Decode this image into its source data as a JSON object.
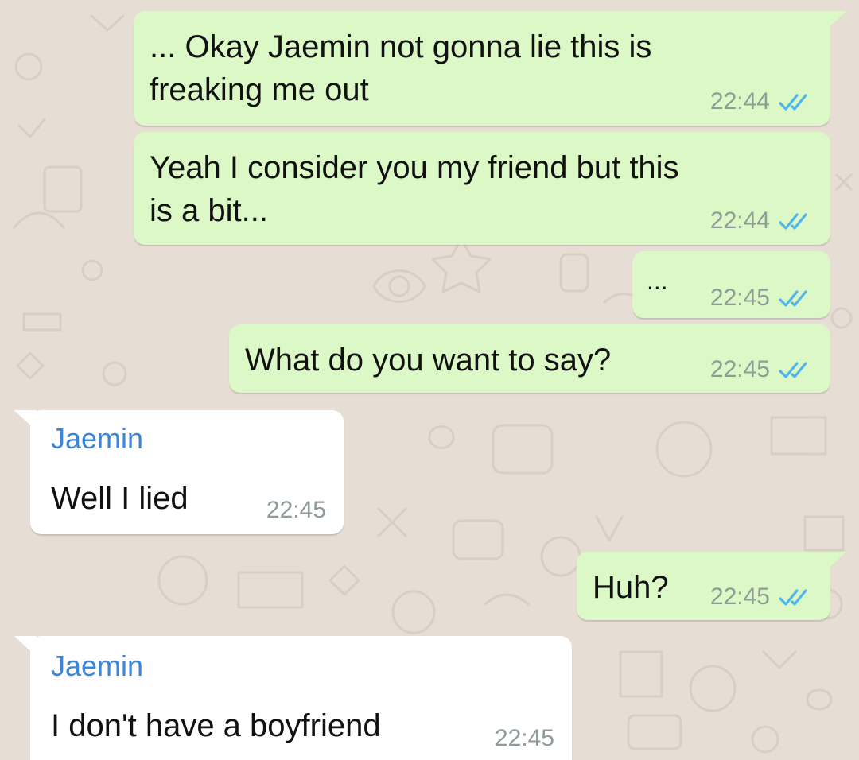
{
  "conversation": {
    "messages": [
      {
        "direction": "outgoing",
        "text": "... Okay Jaemin not gonna lie this is\nfreaking me out",
        "time": "22:44",
        "status": "read"
      },
      {
        "direction": "outgoing",
        "text": "Yeah I consider you my friend but this\nis a bit...",
        "time": "22:44",
        "status": "read"
      },
      {
        "direction": "outgoing",
        "text": "...",
        "time": "22:45",
        "status": "read"
      },
      {
        "direction": "outgoing",
        "text": "What do you want to say?",
        "time": "22:45",
        "status": "read"
      },
      {
        "direction": "incoming",
        "sender": "Jaemin",
        "text": "Well I lied",
        "time": "22:45"
      },
      {
        "direction": "outgoing",
        "text": "Huh?",
        "time": "22:45",
        "status": "read"
      },
      {
        "direction": "incoming",
        "sender": "Jaemin",
        "text": "I don't have a boyfriend",
        "time": "22:45"
      }
    ]
  },
  "colors": {
    "chat_background": "#e6ddd4",
    "outgoing_bubble": "#dcf8c6",
    "incoming_bubble": "#ffffff",
    "sender_name": "#3b86d8",
    "read_ticks": "#4fb6ec",
    "timestamp": "#8f9b96"
  },
  "icons": {
    "read_receipt": "double-check-icon",
    "background_pattern": "doodle-pattern"
  }
}
